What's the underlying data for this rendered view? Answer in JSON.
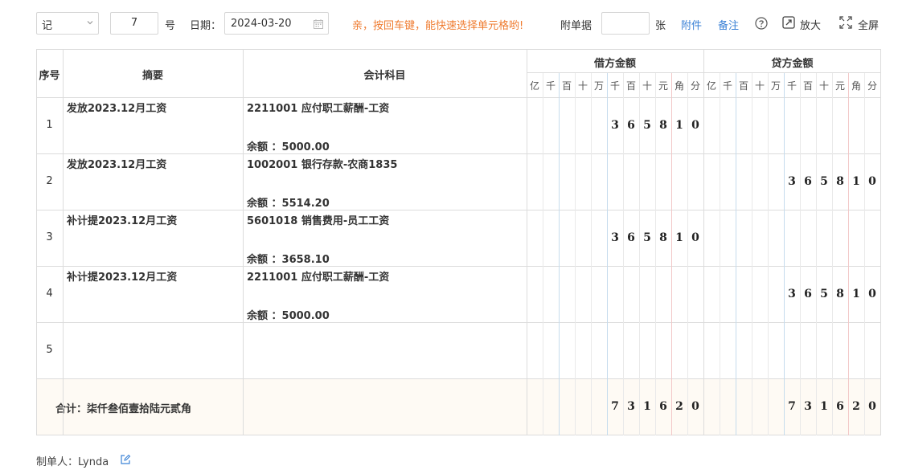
{
  "toolbar": {
    "voucher_type": "记",
    "voucher_number": "7",
    "number_suffix": "号",
    "date_label": "日期：",
    "date_value": "2024-03-20",
    "tip": "亲，按回车键，能快速选择单元格哟!",
    "attachment_label": "附单据",
    "attachment_count": "",
    "attachment_unit": "张",
    "attachment_link": "附件",
    "remark_link": "备注",
    "zoom_label": "放大",
    "fullscreen_label": "全屏",
    "icons": [
      "chevron-down-icon",
      "calendar-icon",
      "help-circle-icon",
      "expand-icon",
      "fullscreen-icon"
    ]
  },
  "table": {
    "headers": {
      "index": "序号",
      "summary": "摘要",
      "account": "会计科目",
      "debit": "借方金额",
      "credit": "贷方金额"
    },
    "units": [
      "亿",
      "千",
      "百",
      "十",
      "万",
      "千",
      "百",
      "十",
      "元",
      "角",
      "分"
    ],
    "balance_prefix": "余额 ：",
    "rows": [
      {
        "index": "1",
        "summary": "发放2023.12月工资",
        "account": "2211001 应付职工薪酬-工资",
        "balance": "5000.00",
        "debit": "365810",
        "credit": ""
      },
      {
        "index": "2",
        "summary": "发放2023.12月工资",
        "account": "1002001 银行存款-农商1835",
        "balance": "5514.20",
        "debit": "",
        "credit": "365810"
      },
      {
        "index": "3",
        "summary": "补计提2023.12月工资",
        "account": "5601018 销售费用-员工工资",
        "balance": "3658.10",
        "debit": "365810",
        "credit": ""
      },
      {
        "index": "4",
        "summary": "补计提2023.12月工资",
        "account": "2211001 应付职工薪酬-工资",
        "balance": "5000.00",
        "debit": "",
        "credit": "365810"
      },
      {
        "index": "5",
        "summary": "",
        "account": "",
        "balance": "",
        "debit": "",
        "credit": ""
      }
    ],
    "total": {
      "label": "合计：柒仟叁佰壹拾陆元贰角",
      "debit": "731620",
      "credit": "731620"
    }
  },
  "footer": {
    "maker": "制单人：Lynda",
    "edit_icon": "edit-icon"
  },
  "colors": {
    "tip": "#ef7b2f",
    "link": "#3b82d6",
    "grid_line": "#dcdcdc",
    "yuan_separator": "#c6dced",
    "wan_separator": "#f2c7c7",
    "total_background": "#fefaf4"
  }
}
